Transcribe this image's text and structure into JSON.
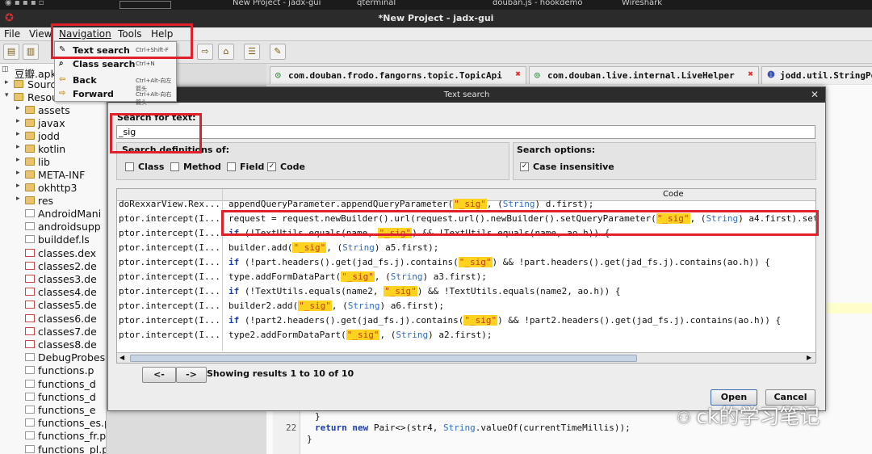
{
  "taskbar": {
    "items": [
      "New Project - jadx-gui",
      "qterminal",
      "douban.js - hookdemo",
      "Wireshark"
    ]
  },
  "window": {
    "title": "*New Project - jadx-gui"
  },
  "menu": {
    "file": "File",
    "view": "View",
    "navigation": "Navigation",
    "tools": "Tools",
    "help": "Help"
  },
  "nav_menu": {
    "items": [
      {
        "label": "Text search",
        "shortcut": "Ctrl+Shift-F"
      },
      {
        "label": "Class search",
        "shortcut": "Ctrl+N"
      },
      {
        "label": "Back",
        "shortcut": "Ctrl+Alt-向左箭头"
      },
      {
        "label": "Forward",
        "shortcut": "Ctrl+Alt-向右箭头"
      }
    ]
  },
  "tree": {
    "root": "豆瓣.apk",
    "source": "Source",
    "resources": "Resou",
    "folders": [
      "assets",
      "javax",
      "jodd",
      "kotlin",
      "lib",
      "META-INF",
      "okhttp3",
      "res"
    ],
    "files": [
      "AndroidMani",
      "androidsupp",
      "builddef.ls",
      "classes.dex",
      "classes2.de",
      "classes3.de",
      "classes4.de",
      "classes5.de",
      "classes6.de",
      "classes7.de",
      "classes8.de",
      "DebugProbes",
      "functions.p",
      "functions_d",
      "functions_d",
      "functions_e",
      "functions_es.properties",
      "functions_fr.properties",
      "functions_pl.properties"
    ]
  },
  "tabs": [
    {
      "label": "com.douban.frodo.fangorns.topic.TopicApi"
    },
    {
      "label": "com.douban.live.internal.LiveHelper"
    },
    {
      "label": "jodd.util.StringPo"
    }
  ],
  "editor": {
    "line_number": "22",
    "code_line": "return new Pair<>(str4, String.valueOf(currentTimeMillis));",
    "close_brace": "}"
  },
  "dialog": {
    "title": "Text search",
    "search_label": "Search for text:",
    "search_value": "_sig",
    "definitions_label": "Search definitions of:",
    "options_label": "Search options:",
    "checkboxes": {
      "class": "Class",
      "method": "Method",
      "field": "Field",
      "code": "Code",
      "case": "Case insensitive"
    },
    "checked": {
      "class": false,
      "method": false,
      "field": false,
      "code": true,
      "case": true
    },
    "column_code": "Code",
    "results": [
      {
        "loc": "doRexxarView.Rex...",
        "code": "appendQueryParameter.appendQueryParameter(\"_sig\", (String) d.first);"
      },
      {
        "loc": "ptor.intercept(I...",
        "code": "request = request.newBuilder().url(request.url().newBuilder().setQueryParameter(\"_sig\", (String) a4.first).setQuery"
      },
      {
        "loc": "ptor.intercept(I...",
        "code": "if (!TextUtils.equals(name, \"_sig\") && !TextUtils.equals(name, ao.h)) {"
      },
      {
        "loc": "ptor.intercept(I...",
        "code": "builder.add(\"_sig\", (String) a5.first);"
      },
      {
        "loc": "ptor.intercept(I...",
        "code": "if (!part.headers().get(jad_fs.j).contains(\"_sig\") && !part.headers().get(jad_fs.j).contains(ao.h)) {"
      },
      {
        "loc": "ptor.intercept(I...",
        "code": "type.addFormDataPart(\"_sig\", (String) a3.first);"
      },
      {
        "loc": "ptor.intercept(I...",
        "code": "if (!TextUtils.equals(name2, \"_sig\") && !TextUtils.equals(name2, ao.h)) {"
      },
      {
        "loc": "ptor.intercept(I...",
        "code": "builder2.add(\"_sig\", (String) a6.first);"
      },
      {
        "loc": "ptor.intercept(I...",
        "code": "if (!part2.headers().get(jad_fs.j).contains(\"_sig\") && !part2.headers().get(jad_fs.j).contains(ao.h)) {"
      },
      {
        "loc": "ptor.intercept(I...",
        "code": "type2.addFormDataPart(\"_sig\", (String) a2.first);"
      }
    ],
    "prev": "<-",
    "next": "->",
    "status": "Showing results 1 to 10 of 10",
    "open": "Open",
    "cancel": "Cancel"
  },
  "watermark": "ck的学习笔记",
  "colors": {
    "highlight": "#ffd21f",
    "annotation": "#e0202a",
    "keyword": "#1f3ea8"
  }
}
